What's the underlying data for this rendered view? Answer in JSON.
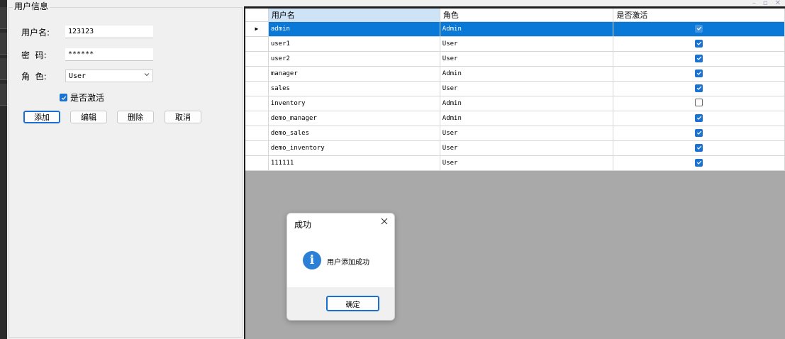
{
  "window": {
    "minimize_icon": "minimize-icon",
    "maximize_icon": "maximize-icon",
    "close_icon": "close-icon"
  },
  "form": {
    "group_title": "用户信息",
    "username_label": "用户名:",
    "username_value": "123123",
    "password_label": "密  码:",
    "password_value": "******",
    "role_label": "角  色:",
    "role_value": "User",
    "active_label": "是否激活",
    "active_checked": true,
    "buttons": {
      "add": "添加",
      "edit": "编辑",
      "delete": "删除",
      "cancel": "取消"
    }
  },
  "grid": {
    "columns": [
      "用户名",
      "角色",
      "是否激活"
    ],
    "rows": [
      {
        "username": "admin",
        "role": "Admin",
        "active": true,
        "selected": true
      },
      {
        "username": "user1",
        "role": "User",
        "active": true
      },
      {
        "username": "user2",
        "role": "User",
        "active": true
      },
      {
        "username": "manager",
        "role": "Admin",
        "active": true
      },
      {
        "username": "sales",
        "role": "User",
        "active": true
      },
      {
        "username": "inventory",
        "role": "Admin",
        "active": false
      },
      {
        "username": "demo_manager",
        "role": "Admin",
        "active": true
      },
      {
        "username": "demo_sales",
        "role": "User",
        "active": true
      },
      {
        "username": "demo_inventory",
        "role": "User",
        "active": true
      },
      {
        "username": "111111",
        "role": "User",
        "active": true
      }
    ]
  },
  "dialog": {
    "title": "成功",
    "message": "用户添加成功",
    "ok_label": "确定",
    "icon": "info-icon"
  },
  "colors": {
    "accent": "#0a78d7",
    "checkbox": "#1a73d1",
    "info": "#2b7fd4",
    "grid_bg": "#a9a9a9"
  }
}
